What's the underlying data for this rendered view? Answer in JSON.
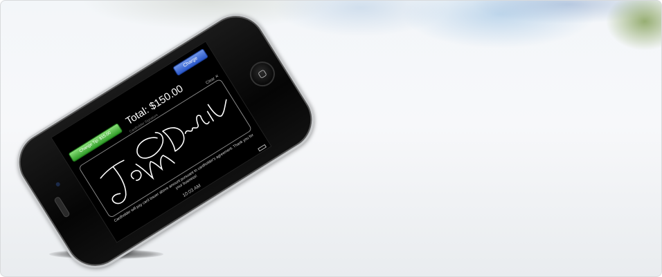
{
  "screen": {
    "charge_button": "Charge",
    "tip_button": "Change Tip: $15.00",
    "total": "Total: $150.00",
    "signature_label": "Cardholder Signature",
    "clear_label": "Clear ✕",
    "disclaimer": "Cardholder will pay card issuer above amount pursuant to cardholder's agreement. Thank you for your business!",
    "status_time": "10:03 AM"
  },
  "colors": {
    "charge_button": "#2856c8",
    "tip_button": "#2d9b26",
    "screen_bg": "#000000"
  }
}
